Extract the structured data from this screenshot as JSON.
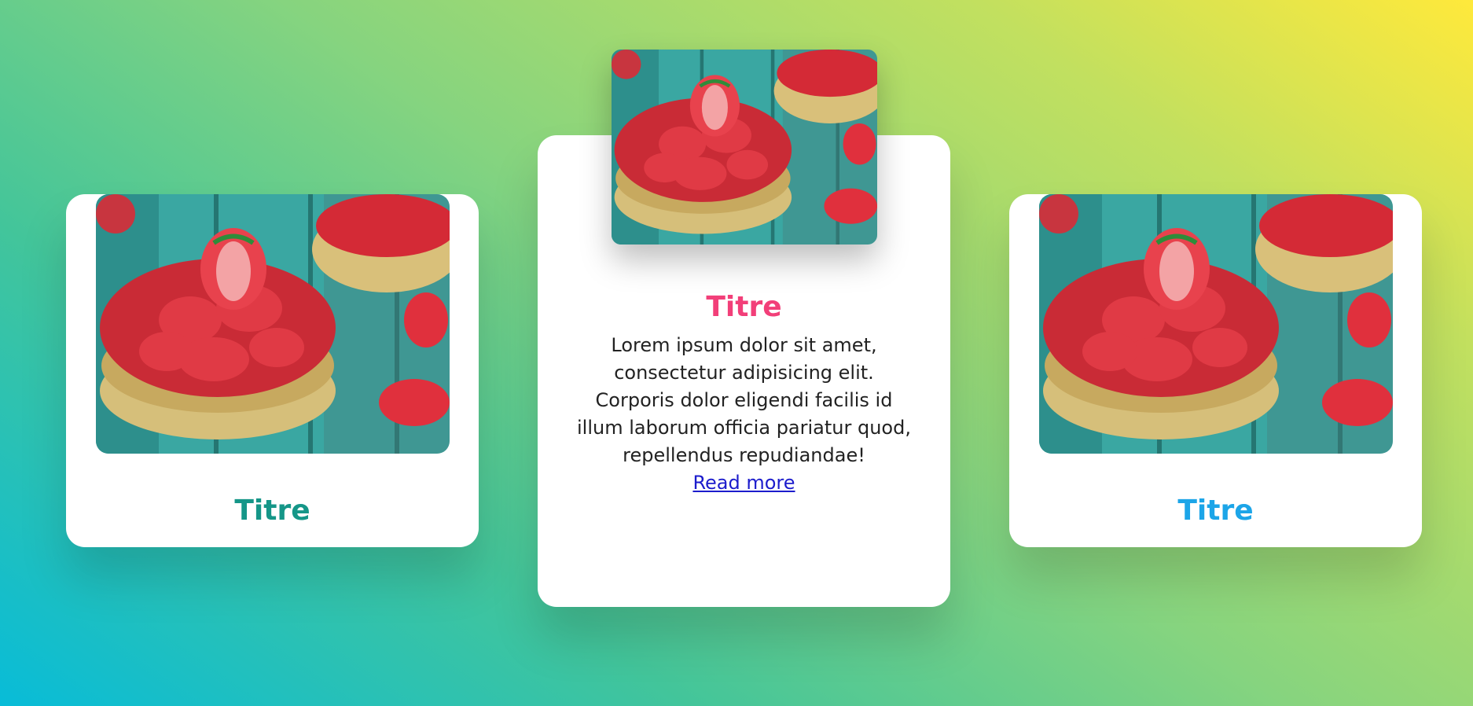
{
  "colors": {
    "background_start": "#08bcd8",
    "background_end": "#ffe93b",
    "title_left": "#159688",
    "title_center": "#f23f79",
    "title_right": "#1ca5e8",
    "link": "#1c1ccc"
  },
  "cards": [
    {
      "title": "Titre",
      "image": "strawberry-tart-image"
    },
    {
      "title": "Titre",
      "image": "strawberry-tart-image",
      "lines": [
        "Lorem ipsum dolor sit amet,",
        "consectetur adipisicing elit.",
        "Corporis dolor eligendi facilis id",
        "illum laborum officia pariatur quod,",
        "repellendus repudiandae!"
      ],
      "link_label": "Read more"
    },
    {
      "title": "Titre",
      "image": "strawberry-tart-image"
    }
  ]
}
